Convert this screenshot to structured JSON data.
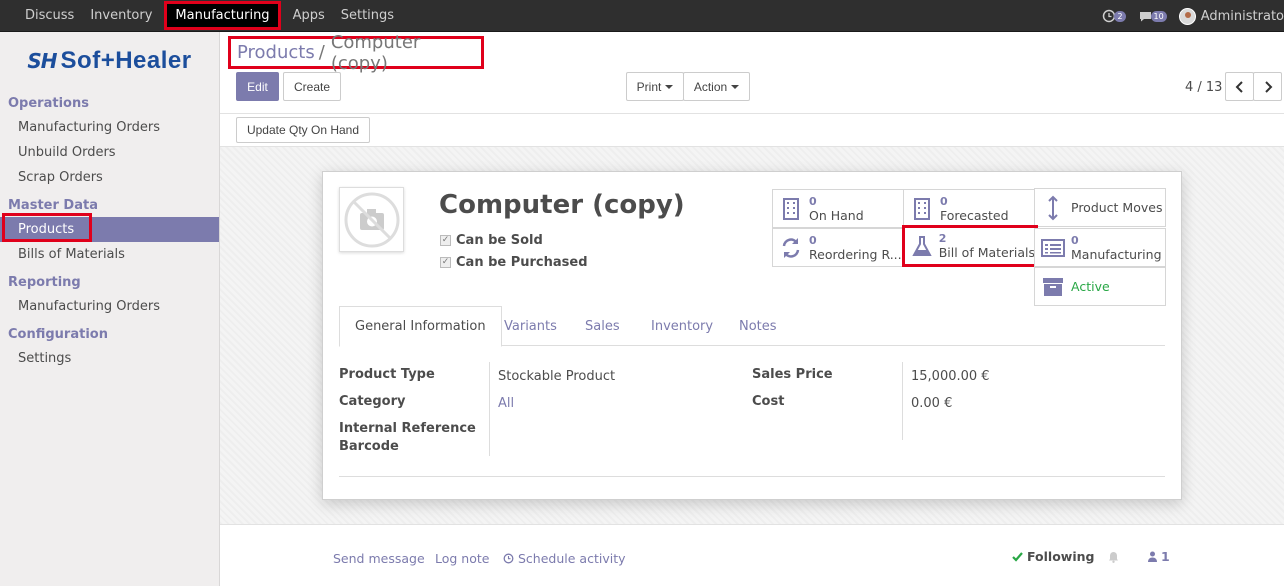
{
  "topnav": {
    "items": [
      "Discuss",
      "Inventory",
      "Manufacturing",
      "Apps",
      "Settings"
    ],
    "active": "Manufacturing",
    "activity_count": "2",
    "messages_count": "10",
    "user": "Administrato"
  },
  "sidebar": {
    "logo_text": "Sof+Healer",
    "sections": [
      {
        "title": "Operations",
        "items": [
          "Manufacturing Orders",
          "Unbuild Orders",
          "Scrap Orders"
        ]
      },
      {
        "title": "Master Data",
        "items": [
          "Products",
          "Bills of Materials"
        ]
      },
      {
        "title": "Reporting",
        "items": [
          "Manufacturing Orders"
        ]
      },
      {
        "title": "Configuration",
        "items": [
          "Settings"
        ]
      }
    ]
  },
  "breadcrumb": {
    "parent": "Products",
    "sep": "/",
    "current": "Computer (copy)"
  },
  "toolbar": {
    "edit": "Edit",
    "create": "Create",
    "print": "Print",
    "action": "Action",
    "pager": "4 / 13",
    "update_qty": "Update Qty On Hand"
  },
  "product": {
    "name": "Computer (copy)",
    "can_be_sold": "Can be Sold",
    "can_be_purchased": "Can be Purchased"
  },
  "stats": {
    "on_hand": {
      "num": "0",
      "label": "On Hand"
    },
    "forecasted": {
      "num": "0",
      "label": "Forecasted"
    },
    "product_moves": {
      "label": "Product Moves"
    },
    "reordering": {
      "num": "0",
      "label": "Reordering R..."
    },
    "bom": {
      "num": "2",
      "label": "Bill of Materials"
    },
    "manufacturing": {
      "num": "0",
      "label": "Manufacturing"
    },
    "active": {
      "label": "Active"
    }
  },
  "tabs": [
    "General Information",
    "Variants",
    "Sales",
    "Inventory",
    "Notes"
  ],
  "fields": {
    "product_type_label": "Product Type",
    "product_type_value": "Stockable Product",
    "category_label": "Category",
    "category_value": "All",
    "internal_ref_label": "Internal Reference",
    "barcode_label": "Barcode",
    "sales_price_label": "Sales Price",
    "sales_price_value": "15,000.00 €",
    "cost_label": "Cost",
    "cost_value": "0.00 €"
  },
  "chatter": {
    "send_message": "Send message",
    "log_note": "Log note",
    "schedule_activity": "Schedule activity",
    "following": "Following",
    "followers": "1"
  },
  "colors": {
    "accent": "#7c7bad",
    "highlight": "#e0001b",
    "topbar": "#2f2f2f",
    "active_green": "#28a745"
  }
}
